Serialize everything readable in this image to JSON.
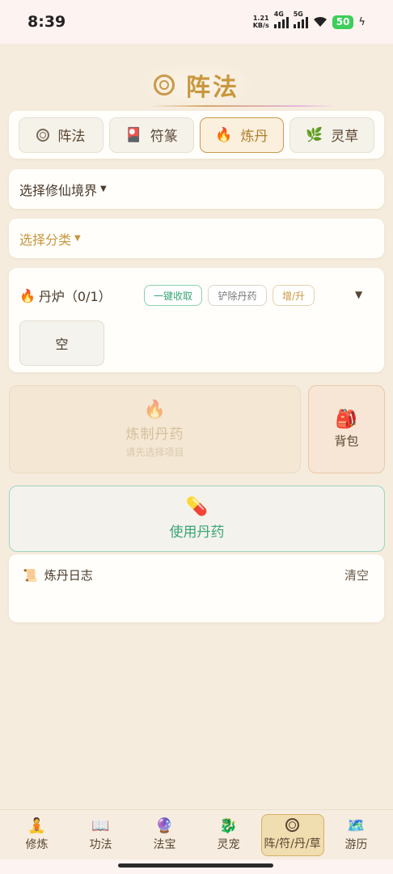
{
  "status_bar": {
    "time": "8:39",
    "net_speed_value": "1.21",
    "net_speed_unit": "KB/s",
    "signal1_label": "4G",
    "signal2_label": "5G",
    "battery": "50"
  },
  "header": {
    "title": "阵法",
    "icon": "array-ring-icon"
  },
  "tabs": [
    {
      "label": "阵法",
      "icon": "ring-icon"
    },
    {
      "label": "符篆",
      "icon": "talisman-card-icon",
      "glyph": "🎴"
    },
    {
      "label": "炼丹",
      "icon": "fire-icon",
      "glyph": "🔥",
      "active": true
    },
    {
      "label": "灵草",
      "icon": "herb-icon",
      "glyph": "🌿"
    }
  ],
  "realm_select": {
    "label": "选择修仙境界"
  },
  "category_select": {
    "label": "选择分类"
  },
  "furnace": {
    "icon_glyph": "🔥",
    "title": "丹炉（0/1）",
    "collect_all": "一键收取",
    "remove_pill": "铲除丹药",
    "upgrade": "增/升",
    "toggle": "▼",
    "slot_label": "空"
  },
  "refine": {
    "icon_glyph": "🔥",
    "label": "炼制丹药",
    "hint": "请先选择项目"
  },
  "backpack": {
    "icon_glyph": "🎒",
    "label": "背包"
  },
  "use_pill": {
    "icon_glyph": "💊",
    "label": "使用丹药"
  },
  "log": {
    "icon_glyph": "📜",
    "title": "炼丹日志",
    "clear": "清空"
  },
  "bottom_nav": [
    {
      "label": "修炼",
      "glyph": "🧘"
    },
    {
      "label": "功法",
      "glyph": "📖"
    },
    {
      "label": "法宝",
      "glyph": "🔮"
    },
    {
      "label": "灵宠",
      "glyph": "🐉"
    },
    {
      "label": "阵/符/丹/草",
      "active": true
    },
    {
      "label": "游历",
      "glyph": "🗺️"
    }
  ],
  "colors": {
    "accent_gold": "#c8973e",
    "accent_green": "#3aa577",
    "background": "#f5ecdd"
  }
}
